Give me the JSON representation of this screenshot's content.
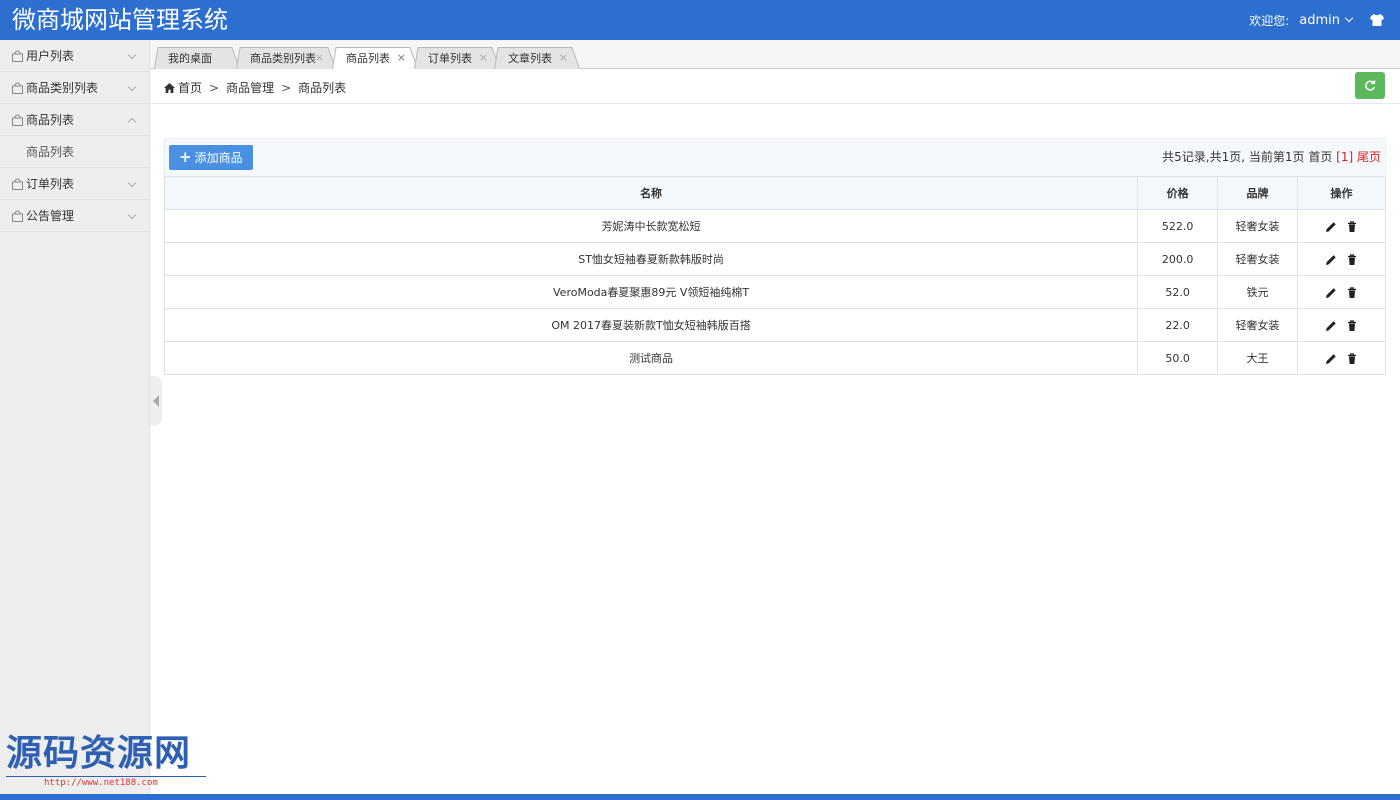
{
  "header": {
    "title": "微商城网站管理系统",
    "welcome": "欢迎您:",
    "username": "admin",
    "icons": [
      "chevron-down-icon",
      "shirt-icon"
    ]
  },
  "sidebar": {
    "items": [
      {
        "label": "用户列表",
        "expanded": false
      },
      {
        "label": "商品类别列表",
        "expanded": false
      },
      {
        "label": "商品列表",
        "expanded": true,
        "children": [
          {
            "label": "商品列表"
          }
        ]
      },
      {
        "label": "订单列表",
        "expanded": false
      },
      {
        "label": "公告管理",
        "expanded": false
      }
    ]
  },
  "tabs": [
    {
      "label": "我的桌面",
      "closable": false,
      "active": false
    },
    {
      "label": "商品类别列表",
      "closable": true,
      "active": false
    },
    {
      "label": "商品列表",
      "closable": true,
      "active": true
    },
    {
      "label": "订单列表",
      "closable": true,
      "active": false
    },
    {
      "label": "文章列表",
      "closable": true,
      "active": false
    }
  ],
  "tab_close_glyph": "×",
  "breadcrumb": {
    "items": [
      "首页",
      "商品管理",
      "商品列表"
    ],
    "separator": ">"
  },
  "toolbar": {
    "add_label": "添加商品",
    "add_glyph": "+"
  },
  "pager": {
    "summary": "共5记录,共1页, 当前第1页",
    "first": "首页",
    "current": "[1]",
    "last": "尾页"
  },
  "table": {
    "columns": [
      "名称",
      "价格",
      "品牌",
      "操作"
    ],
    "rows": [
      {
        "name": "芳妮涛中长款宽松短",
        "price": "522.0",
        "brand": "轻奢女装"
      },
      {
        "name": "ST恤女短袖春夏新款韩版时尚",
        "price": "200.0",
        "brand": "轻奢女装"
      },
      {
        "name": "VeroModa春夏聚惠89元 V领短袖纯棉T",
        "price": "52.0",
        "brand": "铁元"
      },
      {
        "name": "OM 2017春夏装新款T恤女短袖韩版百搭",
        "price": "22.0",
        "brand": "轻奢女装"
      },
      {
        "name": "测试商品",
        "price": "50.0",
        "brand": "大王"
      }
    ],
    "row_actions": [
      "edit-icon",
      "trash-icon"
    ]
  },
  "watermark": {
    "title": "源码资源网",
    "url": "http://www.net188.com"
  },
  "colors": {
    "header": "#2d6fcf",
    "add_button": "#4a90e2",
    "refresh_button": "#5cb85c",
    "pager_highlight": "#e02020"
  }
}
